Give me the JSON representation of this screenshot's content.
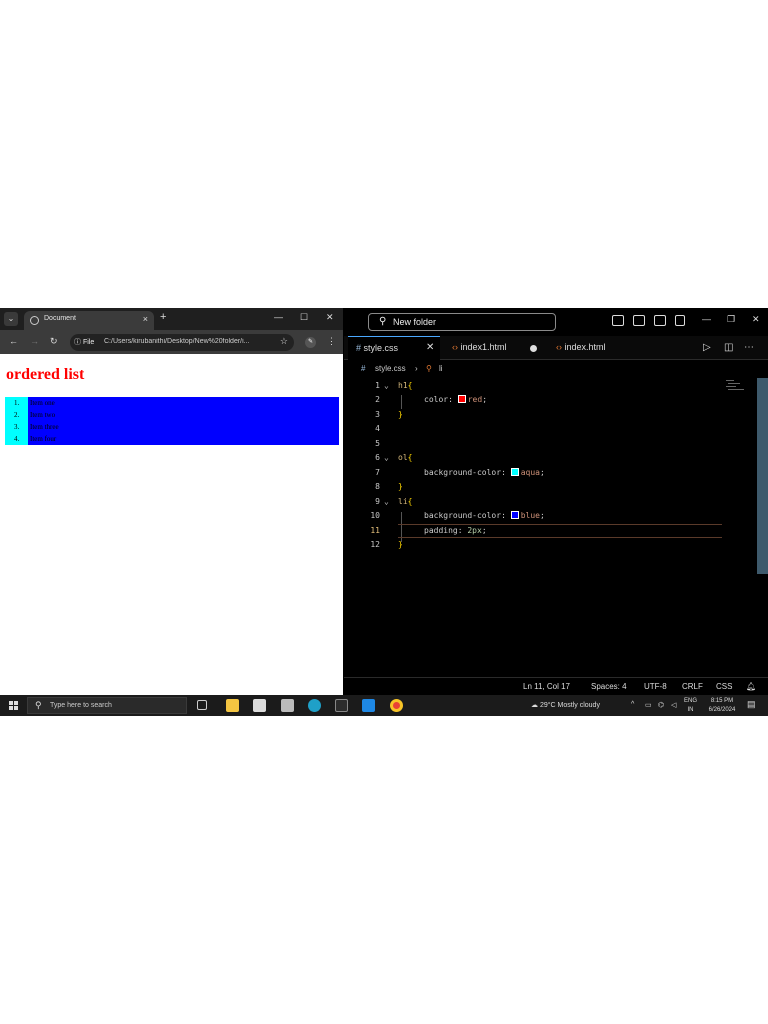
{
  "browser": {
    "tab_title": "Document",
    "tab_close": "×",
    "new_tab": "+",
    "url_chip": "File",
    "url": "C:/Users/kirubanithi/Desktop/New%20folder/i...",
    "page": {
      "heading": "ordered list",
      "list_items": [
        {
          "num": "1.",
          "text": "Item one"
        },
        {
          "num": "2.",
          "text": "Item two"
        },
        {
          "num": "3.",
          "text": "Item three"
        },
        {
          "num": "4.",
          "text": "Item four"
        }
      ]
    }
  },
  "vscode": {
    "command_center": "New folder",
    "tabs": [
      {
        "label": "style.css",
        "icon": "#",
        "active": true
      },
      {
        "label": "index1.html",
        "icon": "<>",
        "active": false
      },
      {
        "label": "index.html",
        "icon": "<>",
        "active": false
      }
    ],
    "breadcrumb": {
      "file": "style.css",
      "symbol": "li"
    },
    "lines": [
      {
        "n": "1",
        "fold": true,
        "text": "h1{"
      },
      {
        "n": "2",
        "text": "color: red;"
      },
      {
        "n": "3",
        "text": "}"
      },
      {
        "n": "4",
        "text": ""
      },
      {
        "n": "5",
        "text": ""
      },
      {
        "n": "6",
        "fold": true,
        "text": "ol{"
      },
      {
        "n": "7",
        "text": "background-color: aqua;"
      },
      {
        "n": "8",
        "text": "}"
      },
      {
        "n": "9",
        "fold": true,
        "text": "li{"
      },
      {
        "n": "10",
        "text": "background-color: blue;"
      },
      {
        "n": "11",
        "text": "padding: 2px;"
      },
      {
        "n": "12",
        "text": "}"
      }
    ],
    "code_parts": {
      "h1_selector": "h1",
      "ol_selector": "ol",
      "li_selector": "li",
      "open_brace": "{",
      "close_brace": "}",
      "color_prop": "color:",
      "red_value": "red",
      "bg_prop": "background-color:",
      "aqua_value": "aqua",
      "blue_value": "blue",
      "padding_prop": "padding:",
      "padding_value": "2px",
      "semicolon": ";"
    },
    "swatch_colors": {
      "red": "#ff0000",
      "aqua": "#00ffff",
      "blue": "#0000ff"
    },
    "status": {
      "position": "Ln 11, Col 17",
      "spaces": "Spaces: 4",
      "encoding": "UTF-8",
      "eol": "CRLF",
      "language": "CSS"
    }
  },
  "taskbar": {
    "search_placeholder": "Type here to search",
    "weather": "29°C  Mostly cloudy",
    "lang_top": "ENG",
    "lang_bottom": "IN",
    "time": "8:15 PM",
    "date": "6/26/2024"
  },
  "colors": {
    "heading_red": "#ff0000",
    "ol_aqua": "#00ffff",
    "li_blue": "#0000ff",
    "vs_background": "#000000",
    "accent_blue": "#4aa8ff"
  }
}
